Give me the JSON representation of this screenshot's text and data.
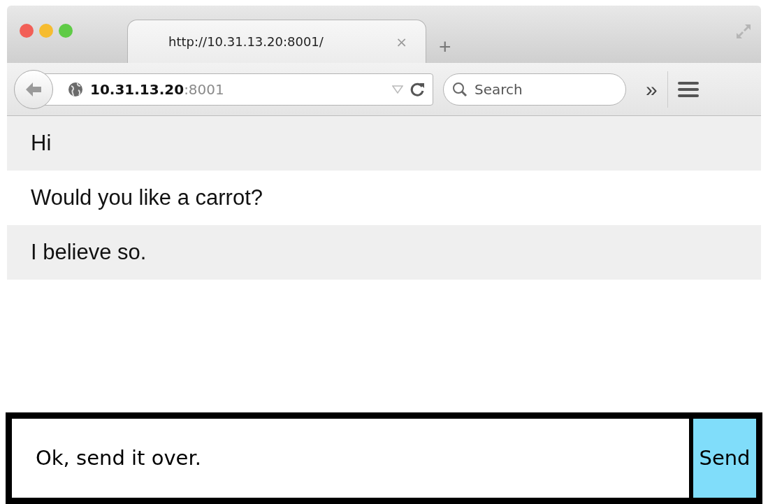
{
  "tab": {
    "title": "http://10.31.13.20:8001/",
    "close": "×",
    "selected": true
  },
  "new_tab": "+",
  "address_bar": {
    "url": "**10.31.13.20**:8001"
  },
  "search": {
    "placeholder": "Search"
  },
  "overflow": "»",
  "messages": [
    "Hi",
    "Would you like a carrot?",
    "I believe so."
  ],
  "composer": {
    "value": "Ok, send it over.",
    "button": "Send"
  }
}
